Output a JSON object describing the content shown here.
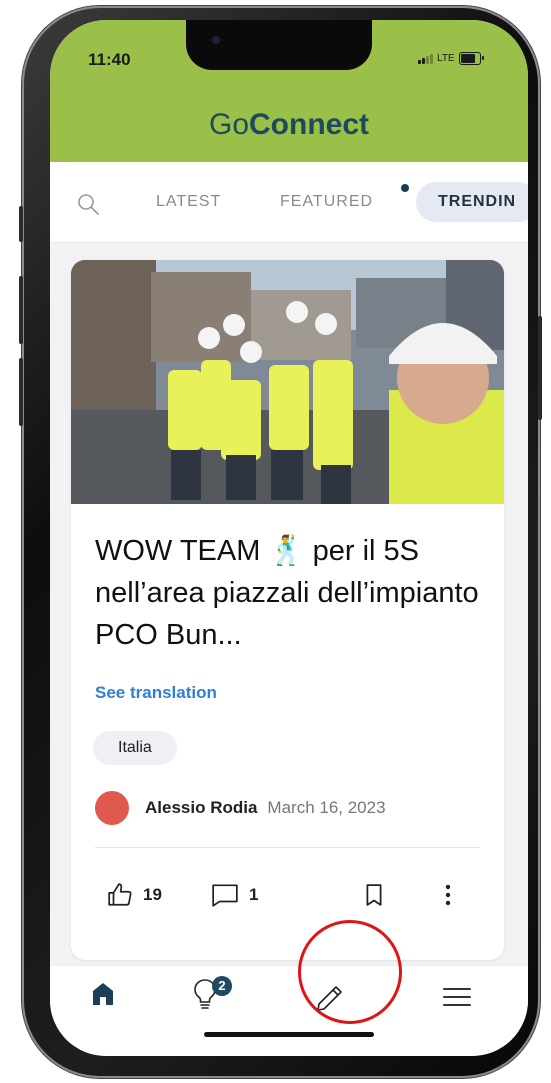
{
  "status_bar": {
    "time": "11:40",
    "network": "LTE",
    "battery_level": 0.8
  },
  "app": {
    "brand_prefix": "Go",
    "brand_suffix": "Connect"
  },
  "tabs": {
    "search_icon": "search-icon",
    "items": [
      {
        "label": "LATEST",
        "active": false
      },
      {
        "label": "FEATURED",
        "active": false
      },
      {
        "label": "TRENDIN",
        "active": true
      }
    ]
  },
  "post": {
    "title": "WOW TEAM 🕺 per il 5S nell’area piazzali dell’impianto PCO Bun...",
    "translation_link": "See translation",
    "tag": "Italia",
    "author": "Alessio Rodia",
    "date": "March 16, 2023",
    "likes": "19",
    "comments": "1"
  },
  "bottom_nav": {
    "items": [
      {
        "icon": "home-icon"
      },
      {
        "icon": "lightbulb-icon",
        "badge": "2"
      },
      {
        "icon": "pencil-icon"
      },
      {
        "icon": "hamburger-menu-icon"
      }
    ]
  },
  "colors": {
    "header": "#9ac04a",
    "brand_text": "#1d4a5e",
    "link": "#2f7fd8",
    "avatar": "#e0594f",
    "highlight": "#e01414"
  }
}
